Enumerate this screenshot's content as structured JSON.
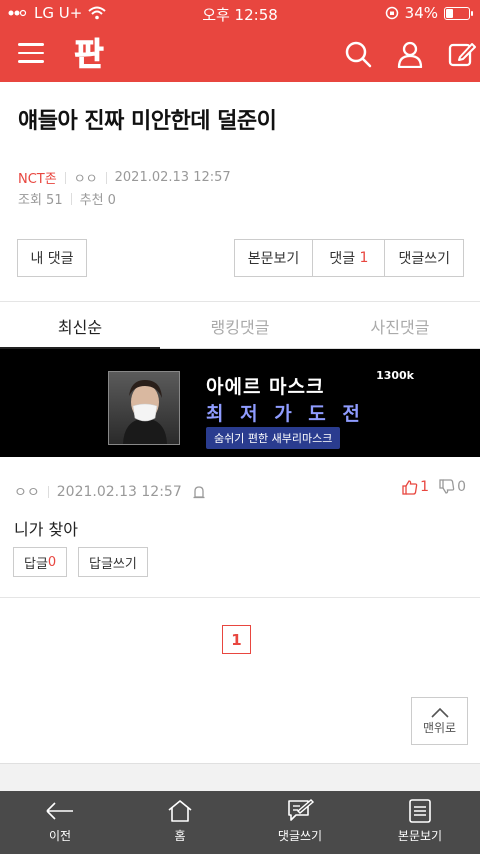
{
  "status_bar": {
    "carrier": "LG U+",
    "time": "오후 12:58",
    "battery": "34%",
    "battery_level": 0.34
  },
  "header": {
    "logo_text": "판",
    "icons": [
      "menu-icon",
      "search-icon",
      "user-icon",
      "write-icon"
    ]
  },
  "article": {
    "title": "얘들아 진짜 미안한데 덜준이",
    "category": "NCT존",
    "author": "ㅇㅇ",
    "date": "2021.02.13 12:57",
    "views_label": "조회 51",
    "recommend_label": "추천 0"
  },
  "buttons": {
    "my_comments": "내 댓글",
    "view_post": "본문보기",
    "comments_label": "댓글",
    "comments_count": "1",
    "write_comment": "댓글쓰기"
  },
  "tabs": [
    {
      "label": "최신순",
      "active": true
    },
    {
      "label": "랭킹댓글",
      "active": false
    },
    {
      "label": "사진댓글",
      "active": false
    }
  ],
  "ad": {
    "brand": "1300k",
    "headline": "아에르 마스크",
    "subhead": "최 저 가 도 전",
    "tagline": "숨쉬기 편한 새부리마스크"
  },
  "comment": {
    "author": "ㅇㅇ",
    "date": "2021.02.13 12:57",
    "up_count": "1",
    "down_count": "0",
    "text": "니가 찾아",
    "reply_label": "답글",
    "reply_count": "0",
    "write_reply": "답글쓰기"
  },
  "pagination": {
    "current": "1"
  },
  "to_top_label": "맨위로",
  "bottom_nav": [
    {
      "label": "이전",
      "icon": "back-arrow-icon"
    },
    {
      "label": "홈",
      "icon": "home-icon"
    },
    {
      "label": "댓글쓰기",
      "icon": "write-comment-icon"
    },
    {
      "label": "본문보기",
      "icon": "document-icon"
    }
  ],
  "colors": {
    "brand_red": "#e8463f",
    "bottom_bar": "#4a4a4a"
  }
}
